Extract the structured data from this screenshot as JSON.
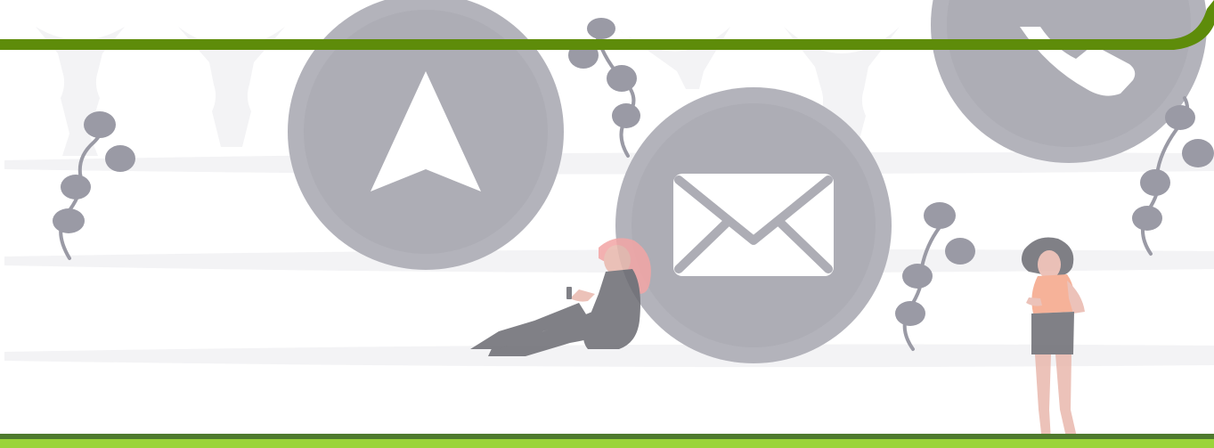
{
  "colors": {
    "background": "#ffffff",
    "faint_shape": "#f3f3f5",
    "icon_circle": "#b3b3bb",
    "icon_circle_inner": "#adadb5",
    "icon_glyph": "#ffffff",
    "vine": "#9a9aa5",
    "accent_top": "#5e8c0a",
    "accent_bottom_dark": "#4e7a2e",
    "accent_bottom_light": "#9ad43a",
    "hair": "#f3a5a5",
    "skin": "#e9b8ad",
    "top_shirt": "#f5a588",
    "dark_clothing": "#6b6b72"
  },
  "icons": {
    "navigation": "navigation-arrow-icon",
    "mail": "mail-envelope-icon",
    "phone": "phone-handset-icon",
    "vine": "vine-leaf-icon"
  },
  "figures": {
    "sitting_person": "sitting-person-with-phone",
    "standing_person": "standing-person-with-phone"
  }
}
